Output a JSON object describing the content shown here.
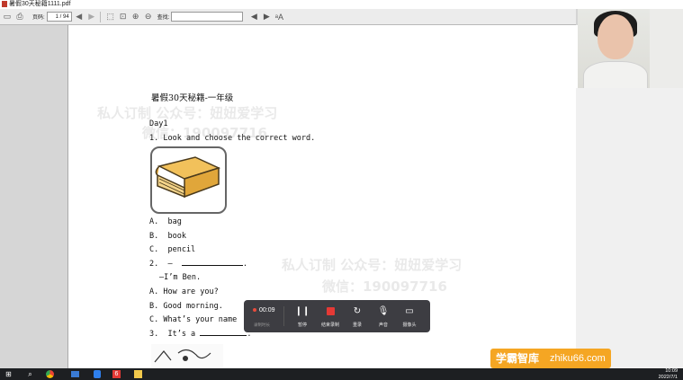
{
  "window": {
    "title": "暑假30天秘籍1111.pdf"
  },
  "toolbar": {
    "page_label": "页码:",
    "page_value": "1 / 94",
    "find_label": "查找:",
    "find_value": ""
  },
  "document": {
    "title": "暑假30天秘籍-一年级",
    "day": "Day1",
    "q1": "1. Look and choose the correct word.",
    "q1_options": [
      "A.  bag",
      "B.  book",
      "C.  pencil"
    ],
    "q2_prompt": "2.  —",
    "q2_answer": "—I’m Ben.",
    "q2_options": [
      "A. How are you?",
      "B. Good morning.",
      "C. What’s your name"
    ],
    "q3": "3.  It’s a"
  },
  "watermarks": [
    "私人订制 公众号：妞妞爱学习",
    "微信：190097716",
    "私人订制 公众号：妞妞爱学习",
    "微信：190097716"
  ],
  "recorder": {
    "time": "00:09",
    "time_label": "录制时长",
    "pause_label": "暂停",
    "stop_label": "结束录制",
    "redo_label": "重录",
    "audio_label": "声音",
    "camera_label": "摄像头"
  },
  "badge": {
    "left": "学霸智库",
    "right": "zhiku66.com"
  },
  "taskbar": {
    "time": "10:09",
    "date": "2022/7/1"
  }
}
